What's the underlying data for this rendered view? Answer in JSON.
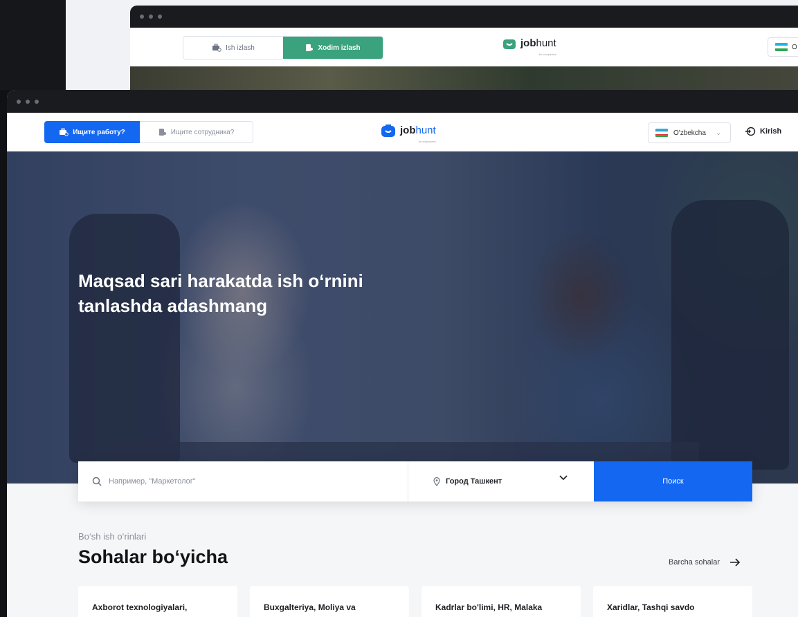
{
  "back_window": {
    "tabs": [
      {
        "label": "Ish izlash",
        "active": false
      },
      {
        "label": "Xodim izlash",
        "active": true
      }
    ],
    "logo": {
      "word_bold": "job",
      "word_light": "hunt",
      "sub": "for companies"
    },
    "language_partial": "O"
  },
  "header": {
    "tab_seek": "Ищите работу?",
    "tab_hire": "Ищите сотрудника?",
    "logo": {
      "word_bold": "job",
      "word_light": "hunt",
      "sub": "for employees"
    },
    "language": "O'zbekcha",
    "login": "Kirish"
  },
  "hero": {
    "title": "Maqsad sari harakatda ish o‘rnini tanlashda adashmang"
  },
  "search": {
    "placeholder": "Например, \"Маркетолог\"",
    "city": "Город Ташкент",
    "button": "Поиск"
  },
  "section": {
    "overline": "Bo‘sh ish o‘rinlari",
    "title": "Sohalar bo‘yicha",
    "all_link": "Barcha sohalar"
  },
  "categories": [
    "Axborot texnologiyalari,",
    "Buxgalteriya, Moliya va",
    "Kadrlar bo'limi, HR, Malaka",
    "Xaridlar, Tashqi savdo"
  ],
  "colors": {
    "primary_blue": "#1467f0",
    "green_accent": "#3aa27c",
    "dark_titlebar": "#1a1b1f"
  }
}
